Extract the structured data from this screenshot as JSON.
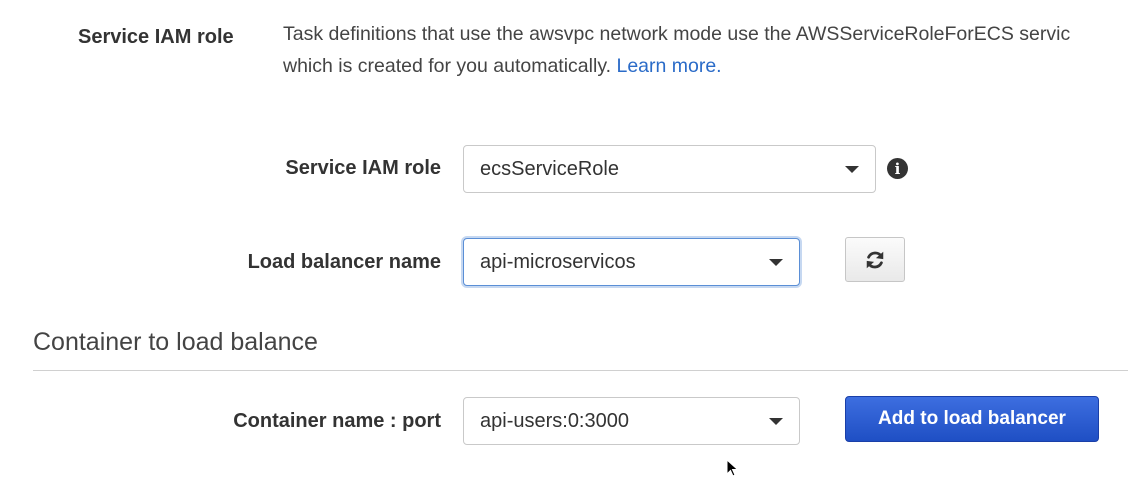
{
  "service_role_info": {
    "label": "Service IAM role",
    "description_line1": "Task definitions that use the awsvpc network mode use the AWSServiceRoleForECS servic",
    "description_line2": "which is created for you automatically.",
    "learn_more": "Learn more."
  },
  "form": {
    "service_iam_role": {
      "label": "Service IAM role",
      "value": "ecsServiceRole",
      "info_icon": "info-icon"
    },
    "load_balancer_name": {
      "label": "Load balancer name",
      "value": "api-microservicos",
      "refresh_icon": "refresh-icon"
    }
  },
  "container_section": {
    "title": "Container to load balance",
    "container_name_port": {
      "label": "Container name : port",
      "value": "api-users:0:3000"
    },
    "add_button": "Add to load balancer"
  },
  "colors": {
    "link": "#2a6bc8",
    "primary_button": "#1f4fc4",
    "focus_ring": "#5b8fd6"
  }
}
